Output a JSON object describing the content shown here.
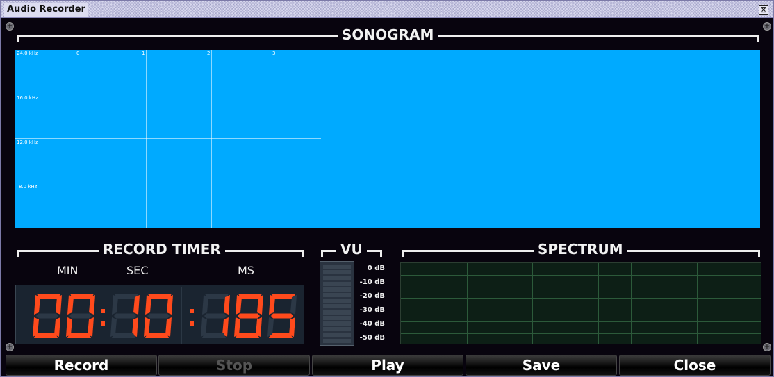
{
  "window": {
    "title": "Audio Recorder",
    "close_glyph": "⊠"
  },
  "sonogram": {
    "title": "SONOGRAM",
    "freq_labels": [
      "24.0 kHz",
      "16.0 kHz",
      "12.0 kHz",
      "8.0 kHz"
    ],
    "sec_labels": [
      "0",
      "1",
      "2",
      "3"
    ],
    "background_color": "#00aaff"
  },
  "timer": {
    "title": "RECORD TIMER",
    "min_label": "MIN",
    "sec_label": "SEC",
    "ms_label": "MS",
    "minutes": "00",
    "seconds": "10",
    "milliseconds": "185",
    "digit_color": "#ff4a1c"
  },
  "vu": {
    "title": "VU",
    "db_labels": [
      "0 dB",
      "-10 dB",
      "-20 dB",
      "-30 dB",
      "-40 dB",
      "-50 dB"
    ],
    "level": 0
  },
  "spectrum": {
    "title": "SPECTRUM"
  },
  "buttons": [
    {
      "label": "Record",
      "enabled": true
    },
    {
      "label": "Stop",
      "enabled": false
    },
    {
      "label": "Play",
      "enabled": true
    },
    {
      "label": "Save",
      "enabled": true
    },
    {
      "label": "Close",
      "enabled": true
    }
  ]
}
